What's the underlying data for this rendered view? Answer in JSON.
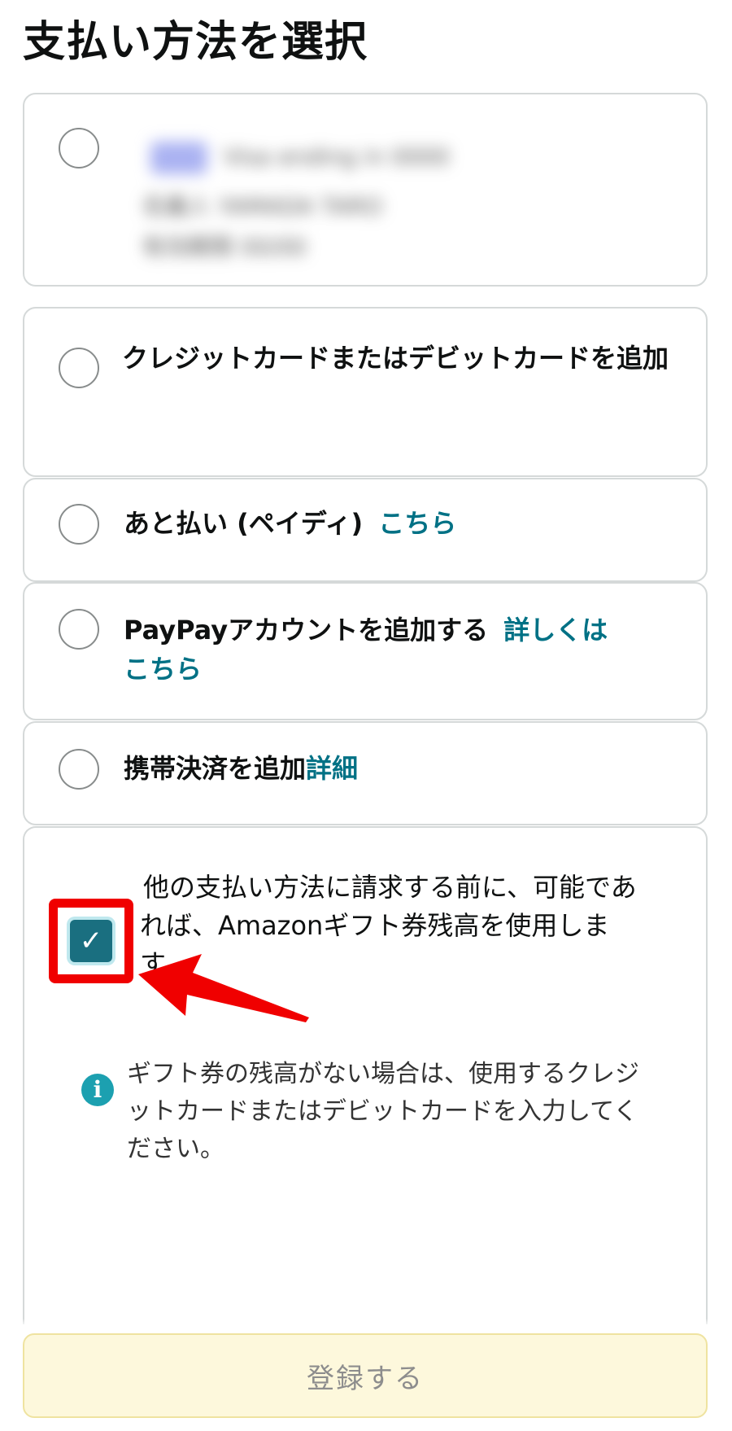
{
  "page": {
    "title": "支払い方法を選択"
  },
  "options": {
    "saved_card": {
      "blurred_line_1": "Visa ending in 0000",
      "blurred_line_2": "名義人 YAMADA TARO",
      "blurred_line_3": "有効期限 00/00"
    },
    "credit_card": {
      "label": "クレジットカードまたはデビットカードを追加"
    },
    "paidy": {
      "label": "あと払い (ペイディ)",
      "link": "こちら"
    },
    "paypay": {
      "label": "PayPayアカウントを追加する",
      "link": "詳しくはこちら"
    },
    "carrier": {
      "label": "携帯決済を追加",
      "link": "詳細"
    }
  },
  "gift_card": {
    "text": "他の支払い方法に請求する前に、可能であれば、Amazonギフト券残高を使用します。",
    "checked": true,
    "check_glyph": "✓",
    "info_icon": "i",
    "info_text": "ギフト券の残高がない場合は、使用するクレジットカードまたはデビットカードを入力してください。",
    "highlight_color": "#f00000"
  },
  "submit": {
    "label": "登録する"
  },
  "colors": {
    "link": "#007185",
    "checkbox": "#1a6f80",
    "info": "#1ca0b0",
    "button_bg": "#fdf8dc"
  }
}
